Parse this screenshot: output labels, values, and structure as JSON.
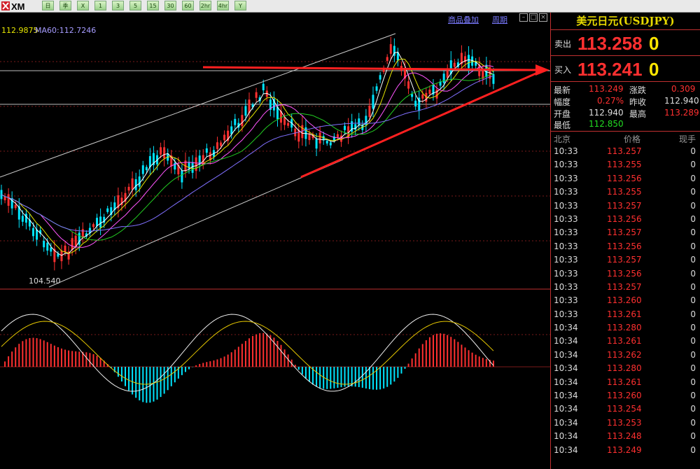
{
  "toolbar": {
    "logo_text": "XM",
    "buttons": [
      "日",
      "季",
      "X",
      "1",
      "3",
      "5",
      "15",
      "30",
      "60",
      "2hr",
      "4hr",
      "Y"
    ]
  },
  "chart": {
    "ma_line_a": "112.9875",
    "ma_line_b": "MA60:112.7246",
    "link_overlay": "商品叠加",
    "link_period": "周期",
    "low_label": "104.540",
    "colors": {
      "up": "#ff3030",
      "down": "#00e5ff",
      "ma5": "#ffffff",
      "ma10": "#e6e600",
      "ma20": "#ff55ff",
      "ma30": "#22cc22",
      "ma60": "#8070ff",
      "grid": "#7a1a1a"
    }
  },
  "panel": {
    "title": "美元日元(USDJPY)",
    "sell_label": "卖出",
    "sell_price": "113.258",
    "sell_vol": "0",
    "buy_label": "买入",
    "buy_price": "113.241",
    "buy_vol": "0",
    "stats": {
      "latest_label": "最新",
      "latest": "113.249",
      "change_label": "涨跌",
      "change": "0.309",
      "range_label": "幅度",
      "range": "0.27%",
      "prev_label": "昨收",
      "prev": "112.940",
      "open_label": "开盘",
      "open": "112.940",
      "high_label": "最高",
      "high": "113.289",
      "low_label": "最低",
      "low": "112.850"
    },
    "ticks_header": {
      "time": "北京",
      "price": "价格",
      "vol": "现手"
    },
    "ticks": [
      {
        "time": "10:33",
        "price": "113.257",
        "vol": "0"
      },
      {
        "time": "10:33",
        "price": "113.255",
        "vol": "0"
      },
      {
        "time": "10:33",
        "price": "113.256",
        "vol": "0"
      },
      {
        "time": "10:33",
        "price": "113.255",
        "vol": "0"
      },
      {
        "time": "10:33",
        "price": "113.257",
        "vol": "0"
      },
      {
        "time": "10:33",
        "price": "113.256",
        "vol": "0"
      },
      {
        "time": "10:33",
        "price": "113.257",
        "vol": "0"
      },
      {
        "time": "10:33",
        "price": "113.256",
        "vol": "0"
      },
      {
        "time": "10:33",
        "price": "113.257",
        "vol": "0"
      },
      {
        "time": "10:33",
        "price": "113.256",
        "vol": "0"
      },
      {
        "time": "10:33",
        "price": "113.257",
        "vol": "0"
      },
      {
        "time": "10:33",
        "price": "113.260",
        "vol": "0"
      },
      {
        "time": "10:33",
        "price": "113.261",
        "vol": "0"
      },
      {
        "time": "10:34",
        "price": "113.280",
        "vol": "0"
      },
      {
        "time": "10:34",
        "price": "113.261",
        "vol": "0"
      },
      {
        "time": "10:34",
        "price": "113.262",
        "vol": "0"
      },
      {
        "time": "10:34",
        "price": "113.280",
        "vol": "0"
      },
      {
        "time": "10:34",
        "price": "113.261",
        "vol": "0"
      },
      {
        "time": "10:34",
        "price": "113.260",
        "vol": "0"
      },
      {
        "time": "10:34",
        "price": "113.254",
        "vol": "0"
      },
      {
        "time": "10:34",
        "price": "113.253",
        "vol": "0"
      },
      {
        "time": "10:34",
        "price": "113.248",
        "vol": "0"
      },
      {
        "time": "10:34",
        "price": "113.249",
        "vol": "0"
      }
    ]
  }
}
